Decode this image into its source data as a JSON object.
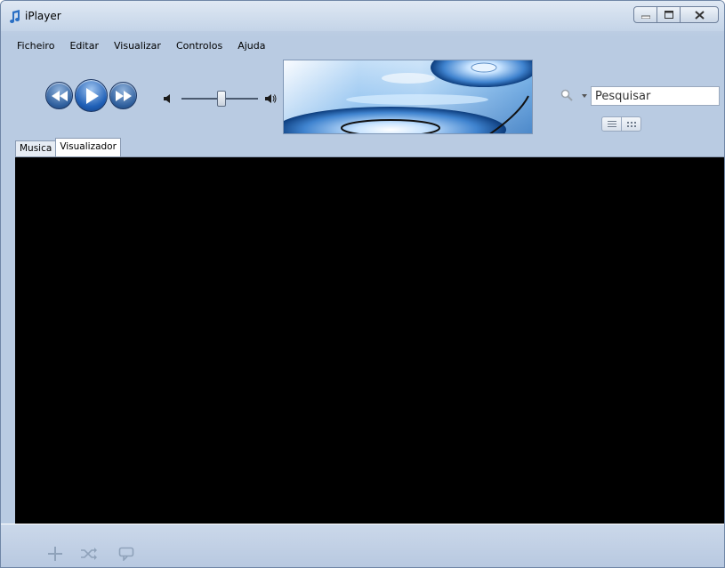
{
  "window": {
    "title": "iPlayer"
  },
  "menu": {
    "items": [
      "Ficheiro",
      "Editar",
      "Visualizar",
      "Controlos",
      "Ajuda"
    ]
  },
  "volume": {
    "level": 0.52
  },
  "search": {
    "placeholder": "Pesquisar"
  },
  "tabs": [
    "Musica",
    "Visualizador"
  ],
  "active_tab": "Visualizador",
  "colors": {
    "accent": "#1f5fb6",
    "visualizer_bg": "#000000",
    "chrome": "#b9cbe2"
  }
}
